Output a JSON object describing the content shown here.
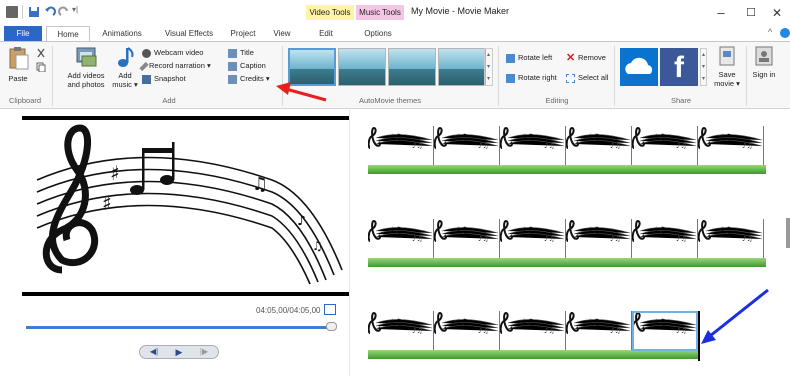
{
  "window": {
    "title": "My Movie - Movie Maker",
    "context_tabs": [
      "Video Tools",
      "Music Tools"
    ],
    "controls": [
      "–",
      "☐",
      "✕"
    ]
  },
  "tabs": [
    "File",
    "Home",
    "Animations",
    "Visual Effects",
    "Project",
    "View",
    "Edit",
    "Options"
  ],
  "ribbon": {
    "clipboard": {
      "paste": "Paste",
      "group": "Clipboard"
    },
    "add": {
      "add_videos": "Add videos and photos",
      "add_music": "Add music ▾",
      "webcam": "Webcam video",
      "record": "Record narration ▾",
      "snapshot": "Snapshot",
      "title": "Title",
      "caption": "Caption",
      "credits": "Credits ▾",
      "group": "Add"
    },
    "themes": {
      "group": "AutoMovie themes"
    },
    "editing": {
      "rotate_left": "Rotate left",
      "rotate_right": "Rotate right",
      "remove": "Remove",
      "select_all": "Select all",
      "group": "Editing"
    },
    "share": {
      "save_movie": "Save movie ▾",
      "sign_in": "Sign in",
      "group": "Share"
    }
  },
  "preview": {
    "time": "04:05,00/04:05,00",
    "progress": 1.0
  },
  "colors": {
    "accent": "#2b67c6",
    "annotation_arrow": "#e8201c",
    "annotation_arrow2": "#1b2fe0",
    "audio": "#4aa537"
  }
}
